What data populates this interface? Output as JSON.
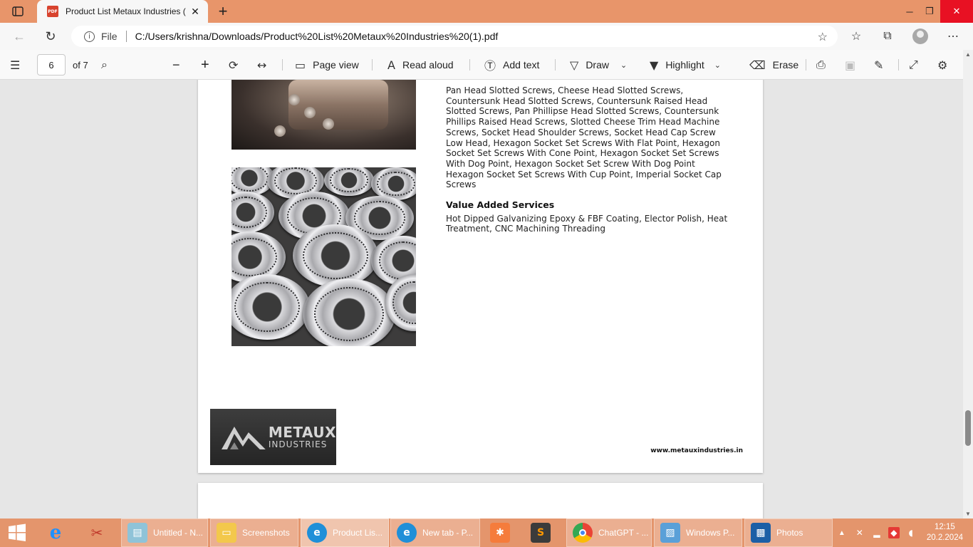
{
  "browser": {
    "tab_title": "Product List Metaux Industries (",
    "tab_favicon": "PDF",
    "address": {
      "scheme_label": "File",
      "url": "C:/Users/krishna/Downloads/Product%20List%20Metaux%20Industries%20(1).pdf"
    },
    "icons": [
      "back-icon",
      "refresh-icon",
      "info-icon",
      "add-favorite-icon",
      "favorites-icon",
      "collections-icon",
      "profile-icon",
      "more-icon"
    ]
  },
  "pdf_toolbar": {
    "current_page": "6",
    "page_count_label": "of 7",
    "page_view_label": "Page view",
    "read_aloud_label": "Read aloud",
    "add_text_label": "Add text",
    "draw_label": "Draw",
    "highlight_label": "Highlight",
    "erase_label": "Erase"
  },
  "pdf_page": {
    "screws_list": "Pan Head Slotted Screws, Cheese Head Slotted Screws, Countersunk Head Slotted Screws, Countersunk Raised Head Slotted Screws, Pan Phillipse Head Slotted Screws, Countersunk Phillips Raised Head Screws, Slotted Cheese Trim Head Machine Screws, Socket Head Shoulder Screws, Socket Head Cap Screw Low Head, Hexagon Socket Set Screws With Flat Point, Hexagon Socket Set Screws With Cone Point, Hexagon Socket Set Screws With Dog Point, Hexagon Socket Set Screw With Dog Point Hexagon Socket Set Screws With Cup Point, Imperial Socket Cap Screws",
    "services_heading": "Value Added Services",
    "services_text": "Hot Dipped Galvanizing Epoxy & FBF Coating, Elector Polish, Heat Treatment, CNC Machining Threading",
    "logo_line1": "METAUX",
    "logo_line2": "INDUSTRIES",
    "website": "www.metauxindustries.in"
  },
  "taskbar": {
    "items": [
      {
        "label": "",
        "icon": "windows-start-icon"
      },
      {
        "label": "",
        "icon": "internet-explorer-icon"
      },
      {
        "label": "",
        "icon": "snipping-tool-icon"
      },
      {
        "label": "Untitled - N...",
        "icon": "notepad-icon"
      },
      {
        "label": "Screenshots",
        "icon": "folder-icon"
      },
      {
        "label": "Product Lis...",
        "icon": "edge-icon"
      },
      {
        "label": "New tab - P...",
        "icon": "edge-icon"
      },
      {
        "label": "",
        "icon": "xampp-icon"
      },
      {
        "label": "",
        "icon": "sublime-icon"
      },
      {
        "label": "ChatGPT - ...",
        "icon": "chrome-icon"
      },
      {
        "label": "Windows P...",
        "icon": "photo-viewer-icon"
      },
      {
        "label": "Photos",
        "icon": "photos-icon"
      }
    ],
    "clock_time": "12:15",
    "clock_date": "20.2.2024"
  },
  "colors": {
    "accent": "#e8956a",
    "taskbar": "#e4956c",
    "close_button": "#e81123"
  }
}
